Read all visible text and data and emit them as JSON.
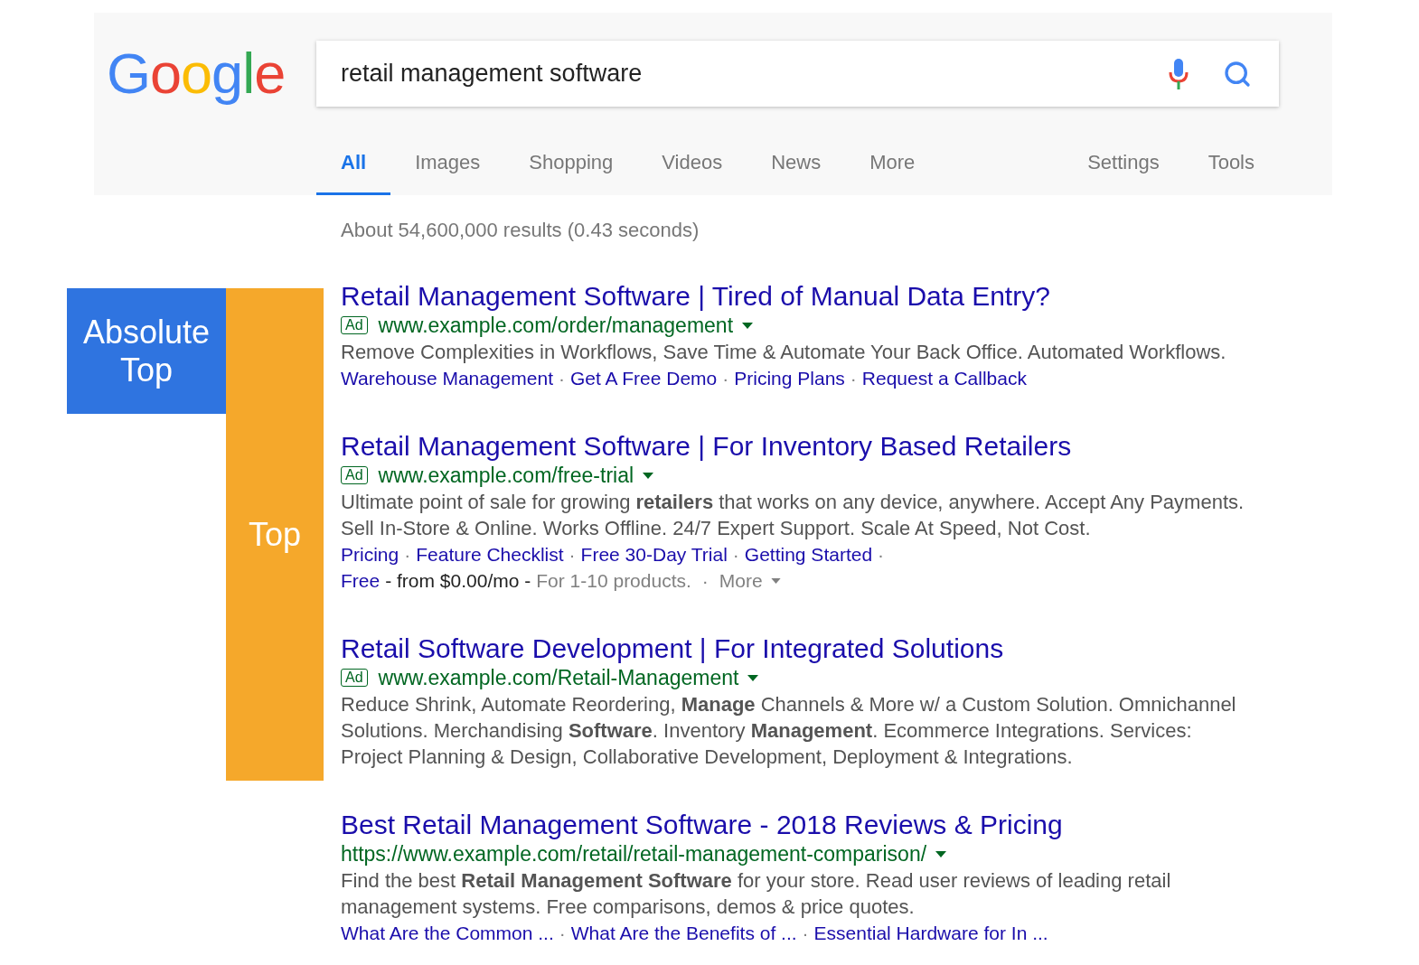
{
  "logo": {
    "letters": [
      {
        "char": "G",
        "color": "#4285f4"
      },
      {
        "char": "o",
        "color": "#ea4335"
      },
      {
        "char": "o",
        "color": "#fbbc05"
      },
      {
        "char": "g",
        "color": "#4285f4"
      },
      {
        "char": "l",
        "color": "#34a853"
      },
      {
        "char": "e",
        "color": "#ea4335"
      }
    ]
  },
  "search": {
    "value": "retail management software"
  },
  "tabs": [
    {
      "label": "All",
      "selected": true
    },
    {
      "label": "Images",
      "selected": false
    },
    {
      "label": "Shopping",
      "selected": false
    },
    {
      "label": "Videos",
      "selected": false
    },
    {
      "label": "News",
      "selected": false
    },
    {
      "label": "More",
      "selected": false
    }
  ],
  "right_tabs": [
    {
      "label": "Settings",
      "selected": false
    },
    {
      "label": "Tools",
      "selected": false
    }
  ],
  "results_count": "About 54,600,000 results (0.43 seconds)",
  "annotations": [
    {
      "label": "Absolute Top",
      "color": "#2f74e0"
    },
    {
      "label": "Top",
      "color": "#f5a82b"
    }
  ],
  "separator": "·",
  "results": [
    {
      "title": "Retail Management Software | Tired of Manual Data Entry?",
      "badge": "Ad",
      "url": "www.example.com/order/management",
      "description": "Remove Complexities in Workflows, Save Time & Automate Your Back Office. Automated Workflows.",
      "sitelinks": [
        "Warehouse Management",
        "Get A Free Demo",
        "Pricing Plans",
        "Request a Callback"
      ]
    },
    {
      "title": "Retail Management Software | For Inventory Based Retailers",
      "badge": "Ad",
      "url": "www.example.com/free-trial",
      "description": "Ultimate point of sale for growing **retailers** that works on any device, anywhere. Accept Any Payments. Sell In-Store & Online. Works Offline. 24/7 Expert Support. Scale At Speed, Not Cost.",
      "sitelinks": [
        "Pricing",
        "Feature Checklist",
        "Free 30-Day Trial",
        "Getting Started"
      ],
      "trailing_separator": true,
      "price_line": [
        {
          "text": "Free",
          "kind": "link"
        },
        {
          "text": "- from $0.00/mo -",
          "kind": "plain"
        },
        {
          "text": "For 1-10 products.",
          "kind": "muted"
        }
      ],
      "more": "More"
    },
    {
      "title": "Retail Software Development | For Integrated Solutions",
      "badge": "Ad",
      "url": "www.example.com/Retail-Management",
      "description": "Reduce Shrink, Automate Reordering, **Manage** Channels & More w/ a Custom Solution. Omnichannel Solutions. Merchandising **Software**. Inventory **Management**. Ecommerce Integrations. Services: Project Planning & Design, Collaborative Development, Deployment & Integrations."
    },
    {
      "title": "Best Retail Management Software - 2018 Reviews & Pricing",
      "url": "https://www.example.com/retail/retail-management-comparison/",
      "description": "Find the best **Retail Management Software** for your store. Read user reviews of leading retail management systems. Free comparisons, demos & price quotes.",
      "sitelinks": [
        "What Are the Common ...",
        "What Are the Benefits of ...",
        "Essential Hardware for In ..."
      ]
    }
  ]
}
